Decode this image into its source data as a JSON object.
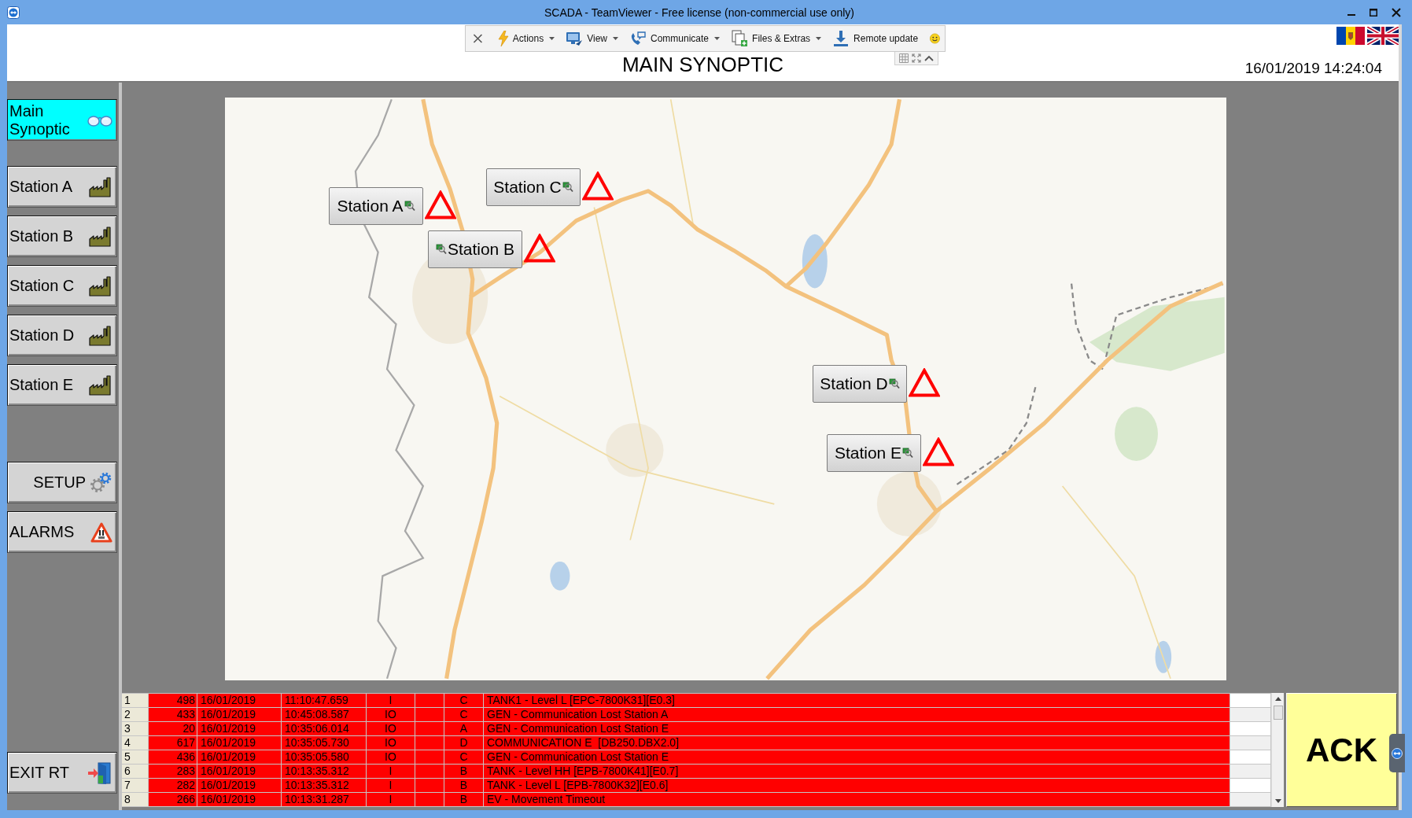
{
  "window": {
    "title": "SCADA - TeamViewer - Free license (non-commercial use only)"
  },
  "remote_toolbar": {
    "items": [
      {
        "label": "Actions",
        "has_menu": true
      },
      {
        "label": "View",
        "has_menu": true
      },
      {
        "label": "Communicate",
        "has_menu": true
      },
      {
        "label": "Files & Extras",
        "has_menu": true
      },
      {
        "label": "Remote update",
        "has_menu": false
      }
    ]
  },
  "header": {
    "title": "MAIN SYNOPTIC",
    "datetime": "16/01/2019 14:24:04"
  },
  "sidebar": {
    "items": [
      {
        "label": "Main Synoptic",
        "kind": "synoptic",
        "selected": true
      },
      {
        "label": "Station A",
        "kind": "station",
        "selected": false
      },
      {
        "label": "Station B",
        "kind": "station",
        "selected": false
      },
      {
        "label": "Station C",
        "kind": "station",
        "selected": false
      },
      {
        "label": "Station D",
        "kind": "station",
        "selected": false
      },
      {
        "label": "Station E",
        "kind": "station",
        "selected": false
      },
      {
        "label": "SETUP",
        "kind": "setup",
        "selected": false
      },
      {
        "label": "ALARMS",
        "kind": "alarms",
        "selected": false
      },
      {
        "label": "EXIT RT",
        "kind": "exit",
        "selected": false
      }
    ]
  },
  "map": {
    "stations": [
      {
        "label": "Station A",
        "alarm": true
      },
      {
        "label": "Station B",
        "alarm": true
      },
      {
        "label": "Station C",
        "alarm": true
      },
      {
        "label": "Station D",
        "alarm": true
      },
      {
        "label": "Station E",
        "alarm": true
      }
    ]
  },
  "alarm_table": {
    "rows": [
      {
        "number": "1",
        "column_2": "498",
        "column_3": "16/01/2019",
        "column_4": "11:10:47.659",
        "column_5": "I",
        "column_7": "C",
        "column_8": "TANK1 - Level L [EPC-7800K31][E0.3]"
      },
      {
        "number": "2",
        "column_2": "433",
        "column_3": "16/01/2019",
        "column_4": "10:45:08.587",
        "column_5": "IO",
        "column_7": "C",
        "column_8": "GEN - Communication Lost Station A"
      },
      {
        "number": "3",
        "column_2": "20",
        "column_3": "16/01/2019",
        "column_4": "10:35:06.014",
        "column_5": "IO",
        "column_7": "A",
        "column_8": "GEN - Communication Lost Station E"
      },
      {
        "number": "4",
        "column_2": "617",
        "column_3": "16/01/2019",
        "column_4": "10:35:05.730",
        "column_5": "IO",
        "column_7": "D",
        "column_8": "COMMUNICATION E  [DB250.DBX2.0]"
      },
      {
        "number": "5",
        "column_2": "436",
        "column_3": "16/01/2019",
        "column_4": "10:35:05.580",
        "column_5": "IO",
        "column_7": "C",
        "column_8": "GEN - Communication Lost Station E"
      },
      {
        "number": "6",
        "column_2": "283",
        "column_3": "16/01/2019",
        "column_4": "10:13:35.312",
        "column_5": "I",
        "column_7": "B",
        "column_8": "TANK - Level HH [EPB-7800K41][E0.7]"
      },
      {
        "number": "7",
        "column_2": "282",
        "column_3": "16/01/2019",
        "column_4": "10:13:35.312",
        "column_5": "I",
        "column_7": "B",
        "column_8": "TANK - Level L [EPB-7800K32][E0.6]"
      },
      {
        "number": "8",
        "column_2": "266",
        "column_3": "16/01/2019",
        "column_4": "10:13:31.287",
        "column_5": "I",
        "column_7": "B",
        "column_8": "EV - Movement Timeout"
      }
    ]
  },
  "ack_button": {
    "label": "ACK"
  }
}
